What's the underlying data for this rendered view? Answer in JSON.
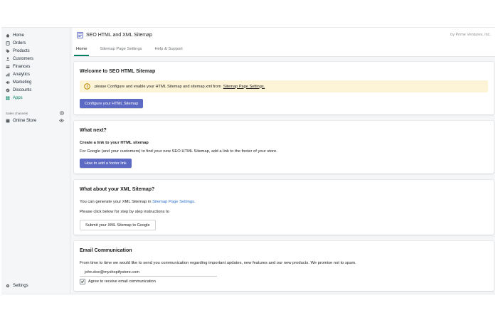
{
  "sidebar": {
    "items": [
      {
        "label": "Home",
        "icon": "home-icon"
      },
      {
        "label": "Orders",
        "icon": "orders-icon"
      },
      {
        "label": "Products",
        "icon": "tag-icon"
      },
      {
        "label": "Customers",
        "icon": "person-icon"
      },
      {
        "label": "Finances",
        "icon": "finances-icon"
      },
      {
        "label": "Analytics",
        "icon": "analytics-icon"
      },
      {
        "label": "Marketing",
        "icon": "marketing-icon"
      },
      {
        "label": "Discounts",
        "icon": "discount-icon"
      },
      {
        "label": "Apps",
        "icon": "apps-icon",
        "active": true
      }
    ],
    "sales_channels_label": "Sales channels",
    "online_store_label": "Online Store",
    "settings_label": "Settings"
  },
  "app": {
    "title": "SEO HTML and XML Sitemap",
    "by_text": "by Prime Ventures, Inc."
  },
  "tabs": [
    "Home",
    "Sitemap Page Settings",
    "Help & Support"
  ],
  "welcome": {
    "heading": "Welcome to SEO HTML Sitemap",
    "banner_pre": "please Configure and enable your HTML Sitemap and sitemap.xml from",
    "banner_link": "Sitemap Page Settings.",
    "button": "Configure your HTML Sitemap"
  },
  "what_next": {
    "heading": "What next?",
    "subheading": "Create a link to your HTML sitemap",
    "text": "For Google (and your customers) to find your new SEO HTML Sitemap, add a link to the footer of your store.",
    "button": "How to add a footer link"
  },
  "xml": {
    "heading": "What about your XML Sitemap?",
    "text_pre": "You can generate your XML Sitemap in",
    "text_link": "Sitemap Page Settings.",
    "instruction": "Please click below for step by step instructions to",
    "button": "Submit your XML Sitemap to Google"
  },
  "email": {
    "heading": "Email Communication",
    "text": "From time to time we would like to send you communication regarding important updates, new features and our new products. We promise not to spam.",
    "input_value": "john.doe@myshopifystore.com",
    "checkbox_label": "Agree to receive email communication",
    "checked": true
  },
  "colors": {
    "accent": "#008060",
    "primary_button": "#5c6ac4",
    "banner": "#fdf4d7",
    "link": "#2c6ecb"
  }
}
